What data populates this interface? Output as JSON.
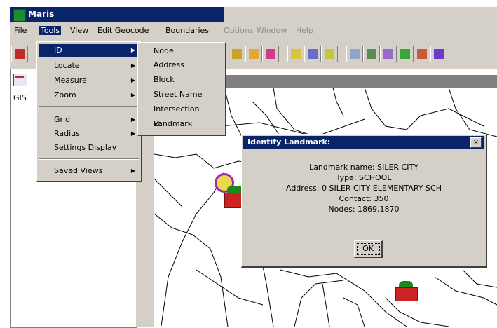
{
  "window": {
    "title": "Maris"
  },
  "menubar": {
    "file": "File",
    "tools": "Tools",
    "view": "View",
    "edit_geocode": "Edit Geocode",
    "boundaries": "Boundaries",
    "options": "Options",
    "window": "Window",
    "help": "Help"
  },
  "tree": {
    "root_label": "GIS"
  },
  "tools_menu": {
    "items": [
      {
        "label": "ID",
        "submenu": true
      },
      {
        "label": "Locate",
        "submenu": true
      },
      {
        "label": "Measure",
        "submenu": true
      },
      {
        "label": "Zoom",
        "submenu": true
      },
      {
        "label": "Grid",
        "submenu": true
      },
      {
        "label": "Radius",
        "submenu": true
      },
      {
        "label": "Settings Display",
        "submenu": false
      },
      {
        "label": "Saved Views",
        "submenu": true
      }
    ]
  },
  "id_submenu": {
    "items": [
      {
        "label": "Node"
      },
      {
        "label": "Address"
      },
      {
        "label": "Block"
      },
      {
        "label": "Street Name"
      },
      {
        "label": "Intersection"
      },
      {
        "label": "Landmark",
        "checked": true
      }
    ],
    "check_glyph": "✔"
  },
  "dialog": {
    "title": "Identify Landmark:",
    "close_label": "×",
    "lines": [
      "Landmark name: SILER CITY",
      "Type: SCHOOL",
      "Address: 0 SILER CITY ELEMENTARY SCH",
      "Contact: 350",
      "Nodes: 1869,1870"
    ],
    "ok_label": "OK"
  },
  "colors": {
    "title_bar": "#0a246a",
    "face": "#d4d0c8",
    "landmark_roof": "#1a8a1a",
    "landmark_body": "#cc2222",
    "locator_ring": "#9a2ab8"
  },
  "icons": [
    "app-icon",
    "map-icon",
    "school-landmark-icon",
    "locator-icon"
  ]
}
